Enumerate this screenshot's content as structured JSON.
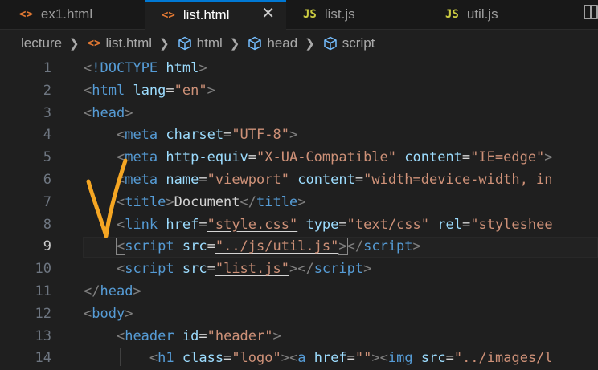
{
  "tabs": [
    {
      "label": "ex1.html",
      "icon": "<>",
      "type": "html",
      "active": false
    },
    {
      "label": "list.html",
      "icon": "<>",
      "type": "html",
      "active": true
    },
    {
      "label": "list.js",
      "icon": "JS",
      "type": "js",
      "active": false
    },
    {
      "label": "util.js",
      "icon": "JS",
      "type": "js",
      "active": false
    }
  ],
  "close_glyph": "✕",
  "breadcrumb": {
    "folder": "lecture",
    "file": "list.html",
    "sym1": "html",
    "sym2": "head",
    "sym3": "script"
  },
  "line_numbers": [
    "1",
    "2",
    "3",
    "4",
    "5",
    "6",
    "7",
    "8",
    "9",
    "10",
    "11",
    "12",
    "13",
    "14"
  ],
  "current_line": "9",
  "code": {
    "l1": {
      "doctype": "!DOCTYPE",
      "html": "html"
    },
    "l2": {
      "tag": "html",
      "attr": "lang",
      "val": "\"en\""
    },
    "l3": {
      "tag": "head"
    },
    "l4": {
      "tag": "meta",
      "attr": "charset",
      "val": "\"UTF-8\""
    },
    "l5": {
      "tag": "meta",
      "attr1": "http-equiv",
      "val1": "\"X-UA-Compatible\"",
      "attr2": "content",
      "val2": "\"IE=edge\""
    },
    "l6": {
      "tag": "meta",
      "attr1": "name",
      "val1": "\"viewport\"",
      "attr2": "content",
      "val2": "\"width=device-width, in"
    },
    "l7": {
      "tag": "title",
      "text": "Document"
    },
    "l8": {
      "tag": "link",
      "attr1": "href",
      "val1": "\"style.css\"",
      "attr2": "type",
      "val2": "\"text/css\"",
      "attr3": "rel",
      "val3": "\"styleshee"
    },
    "l9": {
      "tag": "script",
      "attr": "src",
      "val": "\"../js/util.js\""
    },
    "l10": {
      "tag": "script",
      "attr": "src",
      "val": "\"list.js\""
    },
    "l11": {
      "tag": "head"
    },
    "l12": {
      "tag": "body"
    },
    "l13": {
      "tag": "header",
      "attr": "id",
      "val": "\"header\""
    },
    "l14": {
      "tag": "h1",
      "attr": "class",
      "val": "\"logo\"",
      "tag2": "a",
      "attr2": "href",
      "val2": "\"\"",
      "tag3": "img",
      "attr3": "src",
      "val3": "\"../images/l"
    }
  },
  "colors": {
    "tag": "#569cd6",
    "attr": "#9cdcfe",
    "string": "#ce9178",
    "accent": "#0078d4",
    "annotation": "#f5a623"
  }
}
